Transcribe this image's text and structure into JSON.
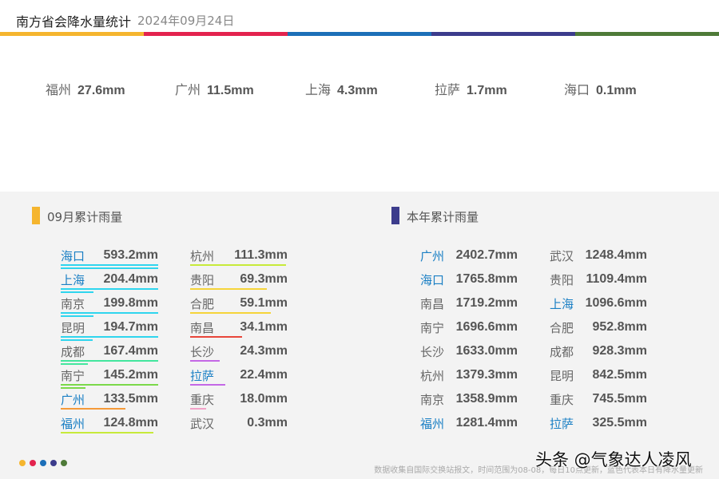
{
  "header": {
    "title": "南方省会降水量统计",
    "date": "2024年09月24日"
  },
  "colorbar": [
    "#f5b52e",
    "#e3234e",
    "#1c6fb8",
    "#3c3c8c",
    "#4e7a38"
  ],
  "today": [
    {
      "city": "福州",
      "value": "27.6mm"
    },
    {
      "city": "广州",
      "value": "11.5mm"
    },
    {
      "city": "上海",
      "value": "4.3mm"
    },
    {
      "city": "拉萨",
      "value": "1.7mm"
    },
    {
      "city": "海口",
      "value": "0.1mm"
    }
  ],
  "monthly": {
    "title": "09月累计雨量",
    "mark_color": "#f5b52e",
    "col1": [
      {
        "city": "海口",
        "value": "593.2mm",
        "highlight": true,
        "color": "#2fd5ee",
        "bars": [
          1.0,
          1.0
        ],
        "top": [
          1.0,
          1.0
        ]
      },
      {
        "city": "上海",
        "value": "204.4mm",
        "highlight": true,
        "color": "#2fd5ee",
        "bars": [
          1.0,
          0.34
        ],
        "top": [
          1.0,
          1.0
        ]
      },
      {
        "city": "南京",
        "value": "199.8mm",
        "highlight": false,
        "color": "#2fd5ee",
        "bars": [
          1.0,
          0.34
        ],
        "top": [
          1.0,
          1.0
        ]
      },
      {
        "city": "昆明",
        "value": "194.7mm",
        "highlight": false,
        "color": "#2fd5ee",
        "bars": [
          1.0,
          0.33
        ],
        "top": [
          1.0,
          1.0
        ]
      },
      {
        "city": "成都",
        "value": "167.4mm",
        "highlight": false,
        "color": "#43e69e",
        "bars": [
          1.0,
          0.28
        ],
        "top": [
          1.0,
          1.0
        ]
      },
      {
        "city": "南宁",
        "value": "145.2mm",
        "highlight": false,
        "color": "#7bd94a",
        "bars": [
          1.0,
          0.25
        ],
        "top": [
          1.0,
          1.0
        ]
      },
      {
        "city": "广州",
        "value": "133.5mm",
        "highlight": true,
        "color": "#f59a38",
        "bars": [
          0.66
        ],
        "top": [
          1.0
        ]
      },
      {
        "city": "福州",
        "value": "124.8mm",
        "highlight": true,
        "color": "#c7ea3a",
        "bars": [
          0.95
        ],
        "top": [
          1.0
        ]
      }
    ],
    "col2": [
      {
        "city": "杭州",
        "value": "111.3mm",
        "highlight": false,
        "color": "#c7ea3a",
        "bars": [
          0.98
        ],
        "top": [
          1.0
        ]
      },
      {
        "city": "贵阳",
        "value": "69.3mm",
        "highlight": false,
        "color": "#f5d43a",
        "bars": [
          0.79
        ],
        "top": [
          1.0
        ]
      },
      {
        "city": "合肥",
        "value": "59.1mm",
        "highlight": false,
        "color": "#f5d43a",
        "bars": [
          0.83
        ],
        "top": [
          1.0
        ]
      },
      {
        "city": "南昌",
        "value": "34.1mm",
        "highlight": false,
        "color": "#e8453a",
        "bars": [
          0.53
        ],
        "top": [
          1.0
        ]
      },
      {
        "city": "长沙",
        "value": "24.3mm",
        "highlight": false,
        "color": "#c468e6",
        "bars": [
          0.3
        ],
        "top": [
          1.0
        ]
      },
      {
        "city": "拉萨",
        "value": "22.4mm",
        "highlight": true,
        "color": "#c468e6",
        "bars": [
          0.36
        ],
        "top": [
          1.0
        ]
      },
      {
        "city": "重庆",
        "value": "18.0mm",
        "highlight": false,
        "color": "#f2a2c8",
        "bars": [
          0.16
        ],
        "top": [
          1.0
        ]
      },
      {
        "city": "武汉",
        "value": "0.3mm",
        "highlight": false,
        "color": "#cccccc",
        "bars": [],
        "top": []
      }
    ]
  },
  "yearly": {
    "title": "本年累计雨量",
    "mark_color": "#3c3c8c",
    "col1": [
      {
        "city": "广州",
        "value": "2402.7mm",
        "highlight": true
      },
      {
        "city": "海口",
        "value": "1765.8mm",
        "highlight": true
      },
      {
        "city": "南昌",
        "value": "1719.2mm",
        "highlight": false
      },
      {
        "city": "南宁",
        "value": "1696.6mm",
        "highlight": false
      },
      {
        "city": "长沙",
        "value": "1633.0mm",
        "highlight": false
      },
      {
        "city": "杭州",
        "value": "1379.3mm",
        "highlight": false
      },
      {
        "city": "南京",
        "value": "1358.9mm",
        "highlight": false
      },
      {
        "city": "福州",
        "value": "1281.4mm",
        "highlight": true
      }
    ],
    "col2": [
      {
        "city": "武汉",
        "value": "1248.4mm",
        "highlight": false
      },
      {
        "city": "贵阳",
        "value": "1109.4mm",
        "highlight": false
      },
      {
        "city": "上海",
        "value": "1096.6mm",
        "highlight": true
      },
      {
        "city": "合肥",
        "value": "952.8mm",
        "highlight": false
      },
      {
        "city": "成都",
        "value": "928.3mm",
        "highlight": false
      },
      {
        "city": "昆明",
        "value": "842.5mm",
        "highlight": false
      },
      {
        "city": "重庆",
        "value": "745.5mm",
        "highlight": false
      },
      {
        "city": "拉萨",
        "value": "325.5mm",
        "highlight": true
      }
    ]
  },
  "footer": {
    "dots": [
      "#f5b52e",
      "#e3234e",
      "#1c6fb8",
      "#3c3c8c",
      "#4e7a38"
    ],
    "note": "数据收集自国际交换站报文，时间范围为08-08，每日10点更新，蓝色代表本日有降水量更新",
    "watermark": "头条 @气象达人凌风"
  }
}
